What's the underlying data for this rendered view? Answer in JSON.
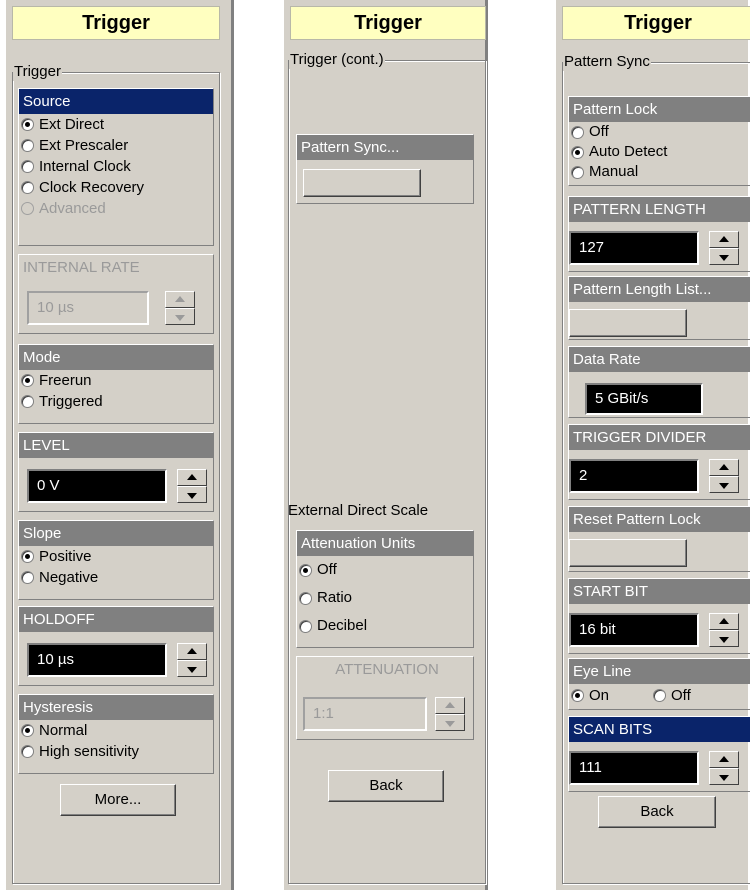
{
  "panel1": {
    "title": "Trigger",
    "group_label": "Trigger",
    "source": {
      "header": "Source",
      "options": [
        "Ext Direct",
        "Ext Prescaler",
        "Internal Clock",
        "Clock Recovery",
        "Advanced"
      ]
    },
    "internal_rate": {
      "header": "INTERNAL RATE",
      "value": "10 µs"
    },
    "mode": {
      "header": "Mode",
      "options": [
        "Freerun",
        "Triggered"
      ]
    },
    "level": {
      "header": "LEVEL",
      "value": "0 V"
    },
    "slope": {
      "header": "Slope",
      "options": [
        "Positive",
        "Negative"
      ]
    },
    "holdoff": {
      "header": "HOLDOFF",
      "value": "10 µs"
    },
    "hysteresis": {
      "header": "Hysteresis",
      "options": [
        "Normal",
        "High sensitivity"
      ]
    },
    "more_button": "More..."
  },
  "panel2": {
    "title": "Trigger",
    "group_label": "Trigger (cont.)",
    "pattern_sync": {
      "header": "Pattern Sync..."
    },
    "ext_direct_scale_label": "External Direct Scale",
    "attenuation_units": {
      "header": "Attenuation Units",
      "options": [
        "Off",
        "Ratio",
        "Decibel"
      ]
    },
    "attenuation": {
      "header": "ATTENUATION",
      "value": "1:1"
    },
    "back_button": "Back"
  },
  "panel3": {
    "title": "Trigger",
    "group_label": "Pattern Sync",
    "pattern_lock": {
      "header": "Pattern Lock",
      "options": [
        "Off",
        "Auto Detect",
        "Manual"
      ]
    },
    "pattern_length": {
      "header": "PATTERN LENGTH",
      "value": "127"
    },
    "pattern_length_list": {
      "header": "Pattern Length List..."
    },
    "data_rate": {
      "header": "Data Rate",
      "value": "5 GBit/s"
    },
    "trigger_divider": {
      "header": "TRIGGER DIVIDER",
      "value": "2"
    },
    "reset_pattern_lock": {
      "header": "Reset Pattern Lock"
    },
    "start_bit": {
      "header": "START BIT",
      "value": "16 bit"
    },
    "eye_line": {
      "header": "Eye Line",
      "options": [
        "On",
        "Off"
      ]
    },
    "scan_bits": {
      "header": "SCAN BITS",
      "value": "111"
    },
    "back_button": "Back"
  },
  "colors": {
    "panel_bg": "#d4d0c8",
    "title_bg": "#ffffc0",
    "header_gray": "#808080",
    "header_active": "#0a246a",
    "value_bg": "#000000"
  },
  "selected": {
    "source": "Ext Direct",
    "mode": "Freerun",
    "slope": "Positive",
    "hysteresis": "Normal",
    "attenuation_units": "Off",
    "pattern_lock": "Auto Detect",
    "eye_line": "On"
  }
}
